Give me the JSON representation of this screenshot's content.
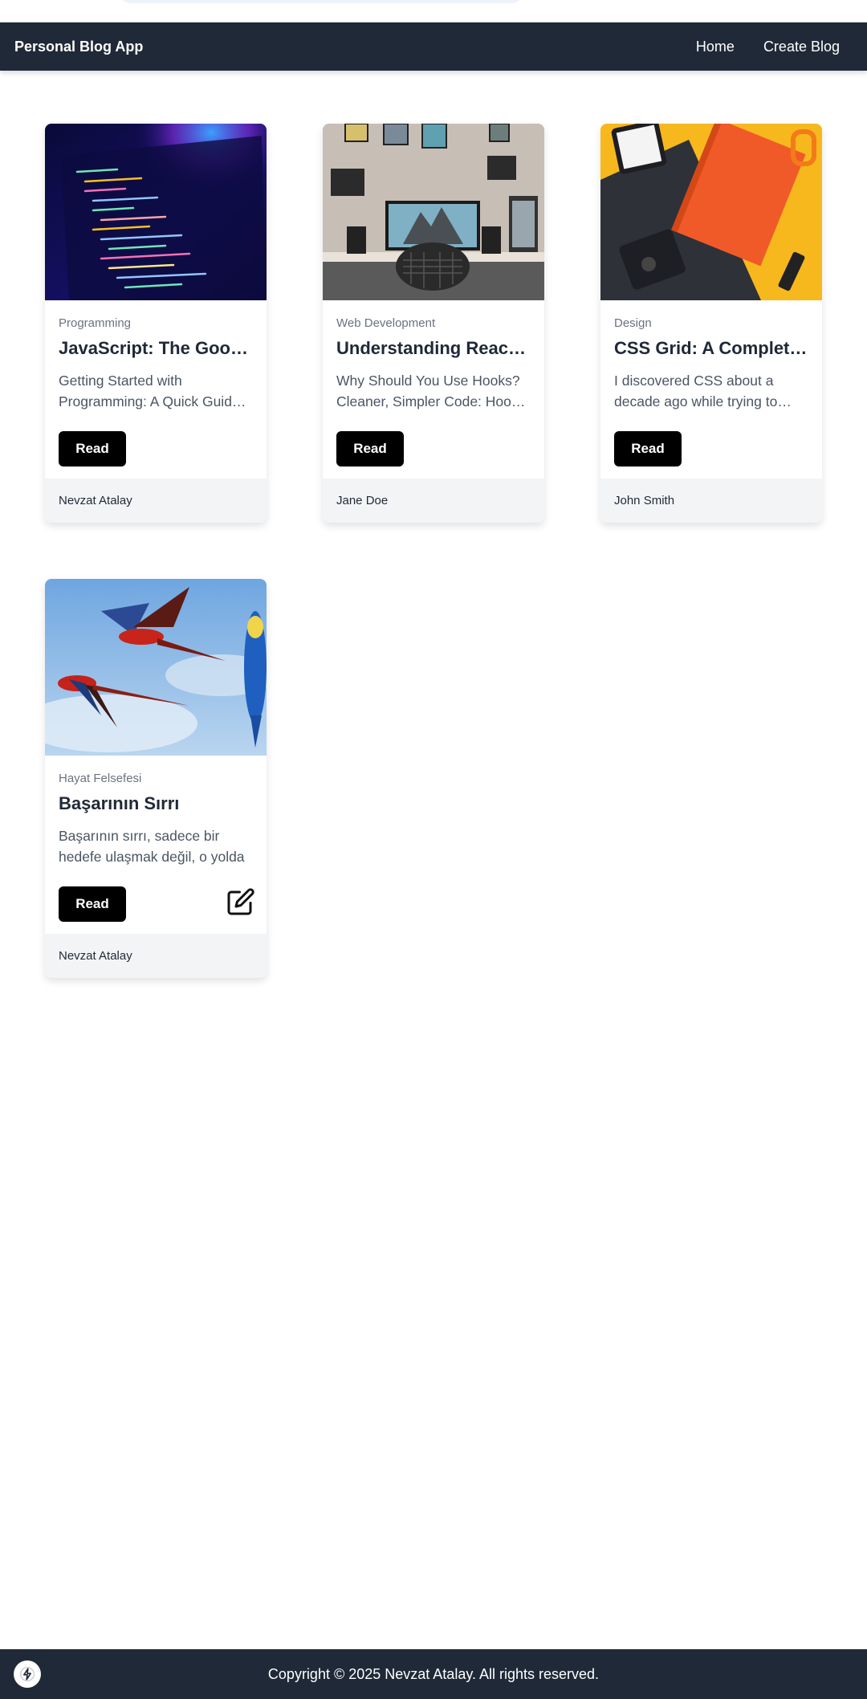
{
  "header": {
    "brand": "Personal Blog App",
    "nav": [
      "Home",
      "Create Blog"
    ]
  },
  "posts": [
    {
      "category": "Programming",
      "title": "JavaScript: The Good Parts",
      "excerpt": "Getting Started with Programming: A Quick Guide for beginners",
      "read_label": "Read",
      "author": "Nevzat Atalay",
      "image": "code-on-laptop-screen",
      "editable": false
    },
    {
      "category": "Web Development",
      "title": "Understanding React Hooks",
      "excerpt": "Why Should You Use Hooks? Cleaner, Simpler Code: Hooks let you",
      "read_label": "Read",
      "author": "Jane Doe",
      "image": "desk-setup-with-monitor",
      "editable": false
    },
    {
      "category": "Design",
      "title": "CSS Grid: A Complete Guide",
      "excerpt": "I discovered CSS about a decade ago while trying to style",
      "read_label": "Read",
      "author": "John Smith",
      "image": "change-by-design-book",
      "editable": false
    },
    {
      "category": "Hayat Felsefesi",
      "title": "Başarının Sırrı",
      "excerpt": "Başarının sırrı, sadece bir hedefe ulaşmak değil, o yolda",
      "read_label": "Read",
      "author": "Nevzat Atalay",
      "image": "flying-parrots",
      "editable": true
    }
  ],
  "footer": {
    "copyright": "Copyright © 2025 Nevzat Atalay. All rights reserved."
  },
  "colors": {
    "nav_bg": "#1f2937",
    "button_bg": "#000000",
    "card_footer_bg": "#f3f4f6"
  }
}
